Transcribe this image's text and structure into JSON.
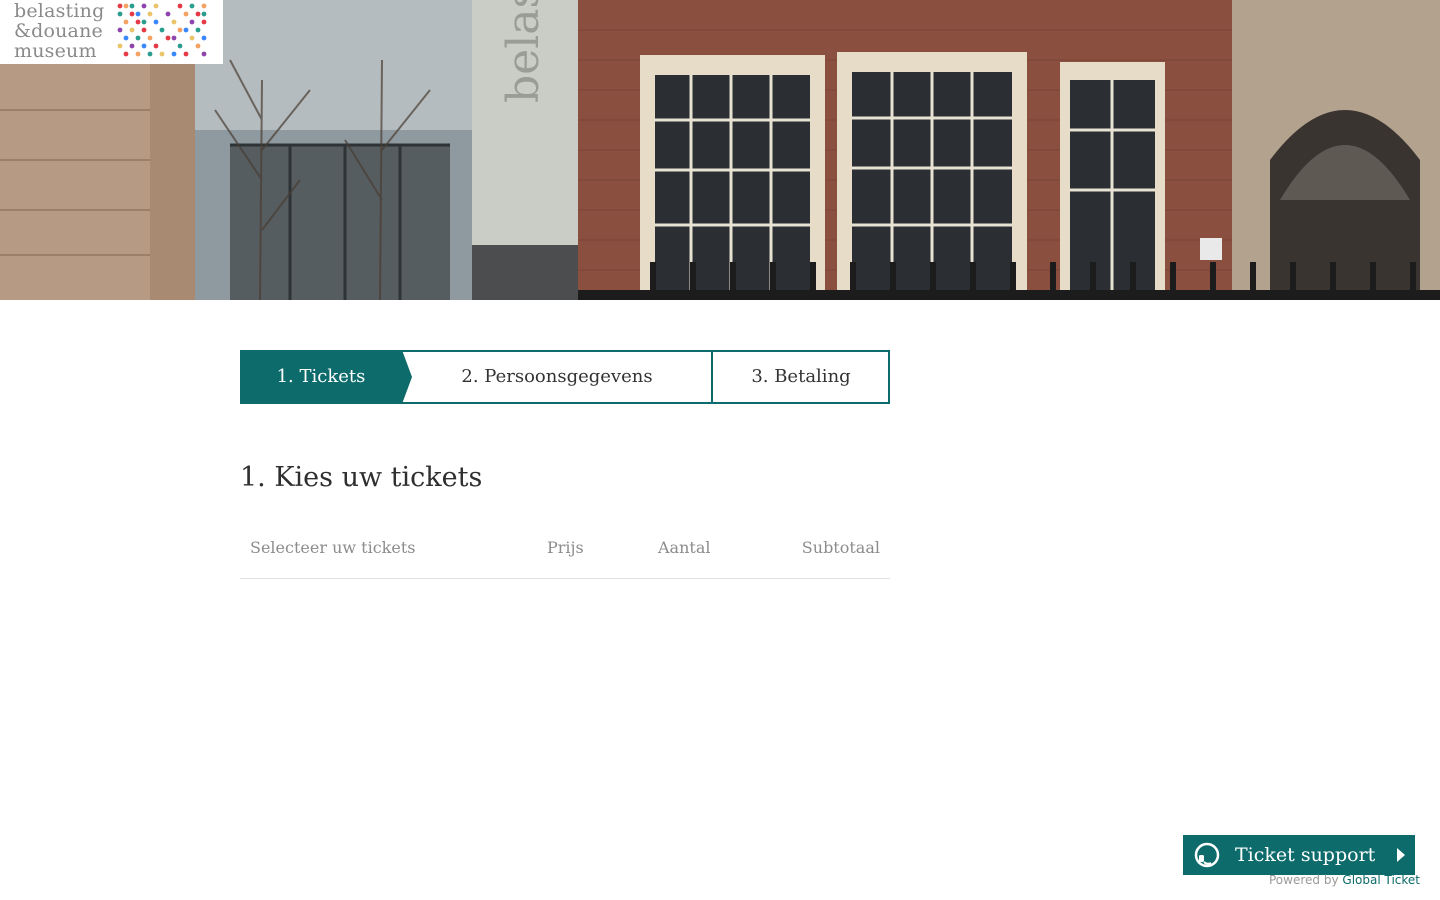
{
  "logo": {
    "line1": "belasting",
    "line2": "&douane",
    "line3": "museum"
  },
  "hero": {
    "sign_text": "belasting"
  },
  "steps": [
    {
      "label": "1. Tickets",
      "active": true
    },
    {
      "label": "2. Persoonsgegevens",
      "active": false
    },
    {
      "label": "3. Betaling",
      "active": false
    }
  ],
  "main": {
    "title": "1. Kies uw tickets",
    "columns": {
      "select": "Selecteer uw tickets",
      "price": "Prijs",
      "quantity": "Aantal",
      "subtotal": "Subtotaal"
    }
  },
  "support": {
    "label": "Ticket support",
    "icon": "headset-icon",
    "powered_prefix": "Powered by",
    "powered_brand": "Global Ticket"
  },
  "colors": {
    "accent": "#0e6b6b",
    "text": "#333333",
    "muted": "#8c8c8c"
  }
}
